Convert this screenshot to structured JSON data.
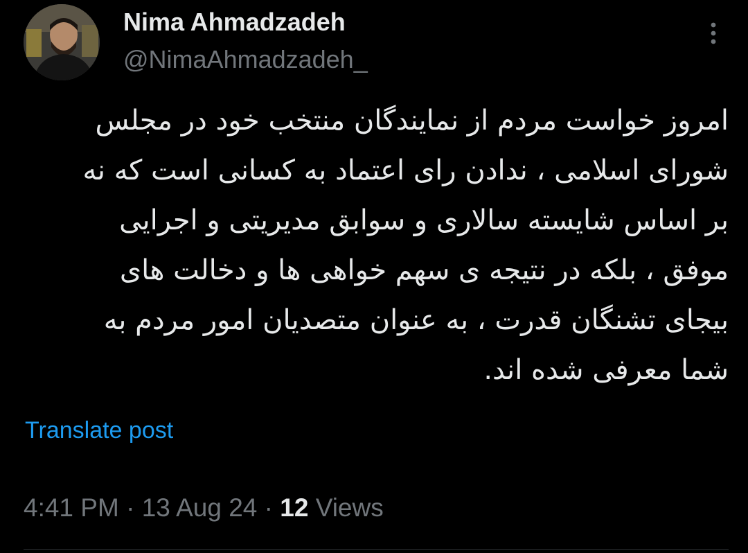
{
  "author": {
    "display_name": "Nima Ahmadzadeh",
    "handle": "@NimaAhmadzadeh_"
  },
  "post": {
    "lines": [
      "امروز خواست مردم از نمایندگان منتخب خود در مجلس",
      "شورای اسلامی ، ندادن رای اعتماد به کسانی  است که نه",
      "بر اساس شایسته سالاری و سوابق مدیریتی و اجرایی",
      "موفق ، بلکه در نتیجه ی سهم خواهی  ها و دخالت های",
      "بیجای تشنگان قدرت ، به عنوان متصدیان امور مردم به",
      "شما معرفی شده اند."
    ],
    "translate_label": "Translate post"
  },
  "meta": {
    "time": "4:41 PM",
    "separator": "·",
    "date": "13 Aug 24",
    "views_count": "12",
    "views_label": "Views"
  },
  "icons": {
    "more": "more-vertical-icon",
    "avatar": "profile-photo"
  },
  "colors": {
    "background": "#000000",
    "primary_text": "#e7e9ea",
    "secondary_text": "#71767b",
    "link": "#1d9bf0"
  }
}
